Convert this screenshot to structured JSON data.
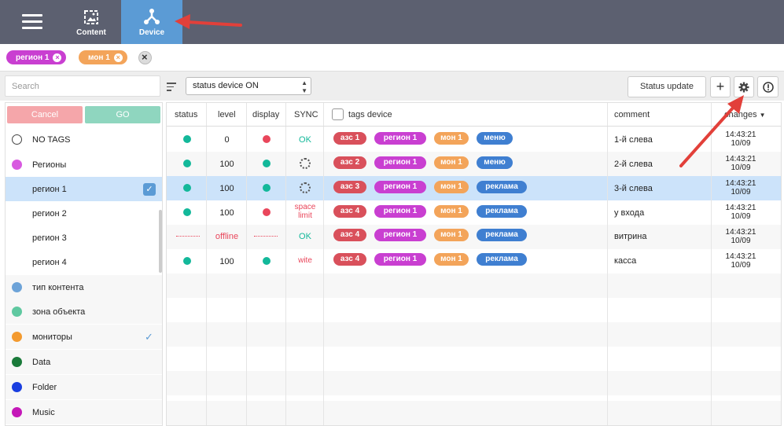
{
  "nav": {
    "tabs": [
      {
        "label": "Content"
      },
      {
        "label": "Device"
      }
    ]
  },
  "filters": {
    "chips": [
      {
        "label": "регион 1",
        "color": "#c93fd1"
      },
      {
        "label": "мон 1",
        "color": "#f3a45a"
      }
    ]
  },
  "toolbar": {
    "search_placeholder": "Search",
    "select_value": "status device  ON",
    "status_update_label": "Status update",
    "plus_label": "+"
  },
  "tags_panel": {
    "cancel_label": "Cancel",
    "go_label": "GO",
    "items": [
      {
        "label": "NO TAGS"
      },
      {
        "label": "Регионы",
        "color": "#d85ae0"
      },
      {
        "label": "регион 1"
      },
      {
        "label": "регион 2"
      },
      {
        "label": "регион 3"
      },
      {
        "label": "регион 4"
      },
      {
        "label": "тип контента",
        "color": "#6da3d8"
      },
      {
        "label": "зона объекта",
        "color": "#5fc8a0"
      },
      {
        "label": "мониторы",
        "color": "#f39a2f"
      },
      {
        "label": "Data",
        "color": "#1a7a3a"
      },
      {
        "label": "Folder",
        "color": "#1a3fe0"
      },
      {
        "label": "Music",
        "color": "#c418b8"
      }
    ]
  },
  "table": {
    "headers": {
      "status": "status",
      "level": "level",
      "display": "display",
      "sync": "SYNC",
      "tags": "tags device",
      "comment": "comment",
      "changes": "changes"
    },
    "rows": [
      {
        "level": "0",
        "sync": "OK",
        "tags": [
          "азс 1",
          "регион 1",
          "мон 1",
          "меню"
        ],
        "comment": "1-й слева",
        "time": "14:43:21",
        "date": "10/09"
      },
      {
        "level": "100",
        "sync": "",
        "tags": [
          "азс 2",
          "регион 1",
          "мон 1",
          "меню"
        ],
        "comment": "2-й слева",
        "time": "14:43:21",
        "date": "10/09"
      },
      {
        "level": "100",
        "sync": "",
        "tags": [
          "азс 3",
          "регион 1",
          "мон 1",
          "реклама"
        ],
        "comment": "3-й слева",
        "time": "14:43:21",
        "date": "10/09"
      },
      {
        "level": "100",
        "sync": "space limit",
        "tags": [
          "азс 4",
          "регион 1",
          "мон 1",
          "реклама"
        ],
        "comment": "у входа",
        "time": "14:43:21",
        "date": "10/09"
      },
      {
        "level": "offline",
        "sync": "OK",
        "tags": [
          "азс 4",
          "регион 1",
          "мон 1",
          "реклама"
        ],
        "comment": "витрина",
        "time": "14:43:21",
        "date": "10/09"
      },
      {
        "level": "100",
        "sync": "wite",
        "tags": [
          "азс 4",
          "регион 1",
          "мон 1",
          "реклама"
        ],
        "comment": "касса",
        "time": "14:43:21",
        "date": "10/09"
      }
    ]
  },
  "colors": {
    "topbar": "#5c6070",
    "accent": "#5b9bd5",
    "status_ok": "#13b89a",
    "status_error": "#e9465b",
    "arrow": "#e2403a"
  }
}
